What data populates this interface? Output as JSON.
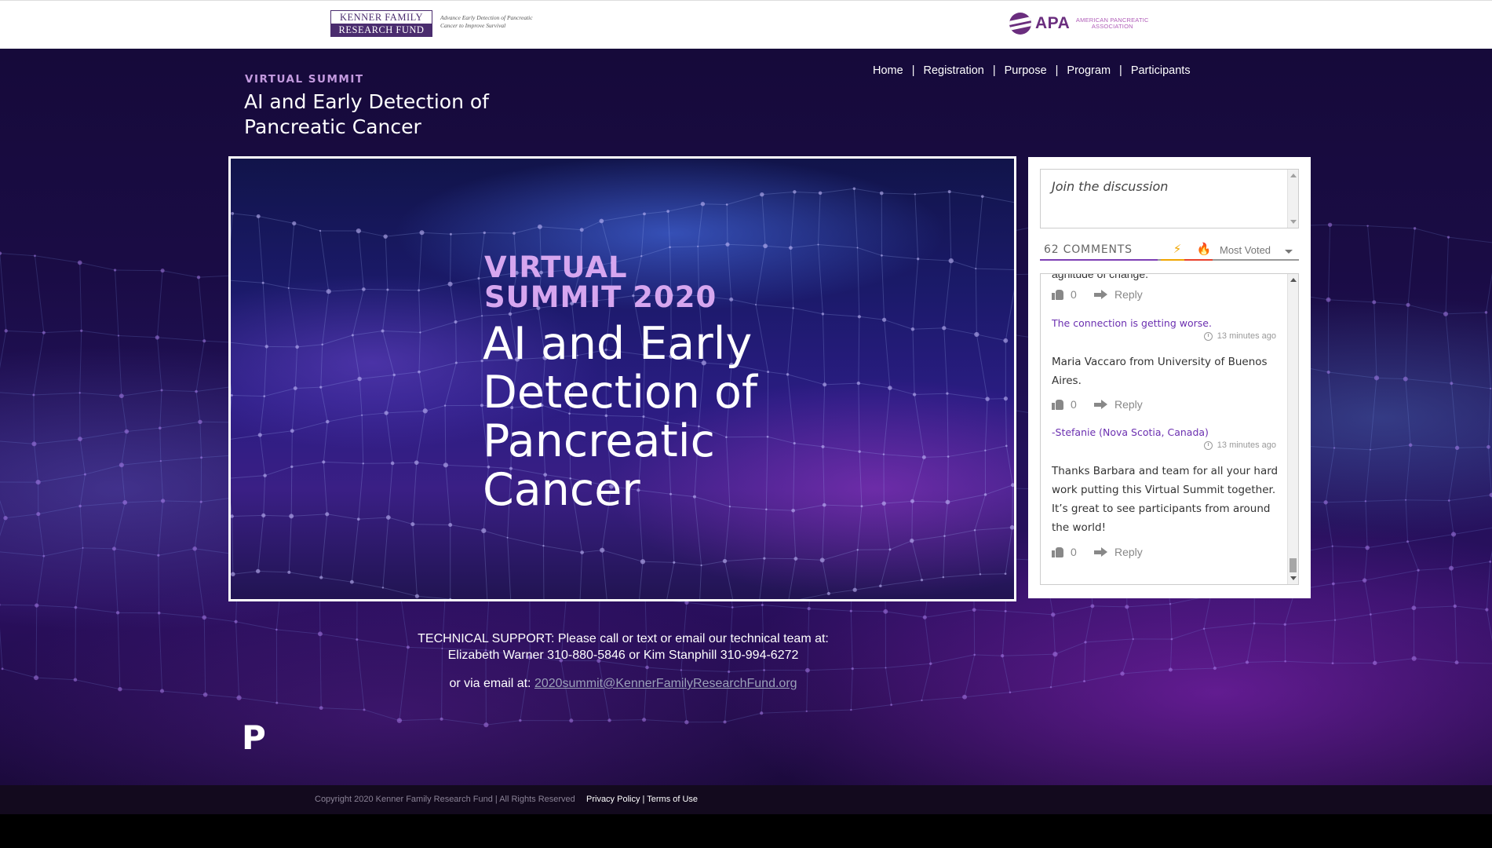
{
  "header": {
    "left_logo": {
      "line1": "KENNER FAMILY",
      "line2": "RESEARCH FUND",
      "tagline": "Advance Early Detection of Pancreatic Cancer to Improve Survival"
    },
    "right_logo": {
      "name": "APA",
      "subtitle": "AMERICAN PANCREATIC ASSOCIATION",
      "icon": "apa-swirl-icon"
    }
  },
  "hero": {
    "label": "VIRTUAL SUMMIT",
    "title": "AI and Early Detection of Pancreatic Cancer"
  },
  "nav": {
    "items": [
      "Home",
      "Registration",
      "Purpose",
      "Program",
      "Participants"
    ],
    "separator": "|"
  },
  "video": {
    "kicker": "VIRTUAL SUMMIT 2020",
    "title": "AI and Early Detection of Pancreatic Cancer"
  },
  "discussion": {
    "placeholder": "Join the discussion",
    "comment_count": "62 COMMENTS",
    "sort": "Most Voted",
    "icons": [
      "bolt-icon",
      "fire-icon"
    ],
    "cut_text": "agnitude of change.",
    "reply_label": "Reply",
    "comments": [
      {
        "author": "The connection is getting worse.",
        "time": "13 minutes ago",
        "text": "Maria Vaccaro from University of Buenos Aires.",
        "votes": "0"
      },
      {
        "author": "-Stefanie (Nova Scotia, Canada)",
        "time": "13 minutes ago",
        "text": "Thanks Barbara and team for all your hard work putting this Virtual Summit together. It’s great to see participants from around the world!",
        "votes": "0"
      }
    ],
    "first_votes": "0"
  },
  "support": {
    "line1": "TECHNICAL SUPPORT: Please call or text or email our technical team at:",
    "line2": "Elizabeth Warner 310-880-5846 or Kim Stanphill 310-994-6272",
    "email_prefix": "or via email at: ",
    "email": "2020summit@KennerFamilyResearchFund.org"
  },
  "p_mark": "P",
  "footer": {
    "copyright": "Copyright 2020 Kenner Family Research Fund | All Rights Reserved",
    "privacy": "Privacy Policy",
    "separator": "|",
    "terms": "Terms of Use"
  },
  "colors": {
    "accent_purple": "#6b2fb0",
    "hero_bg": "#1a0c45",
    "bolt": "#f0a500",
    "fire": "#e8412c"
  }
}
